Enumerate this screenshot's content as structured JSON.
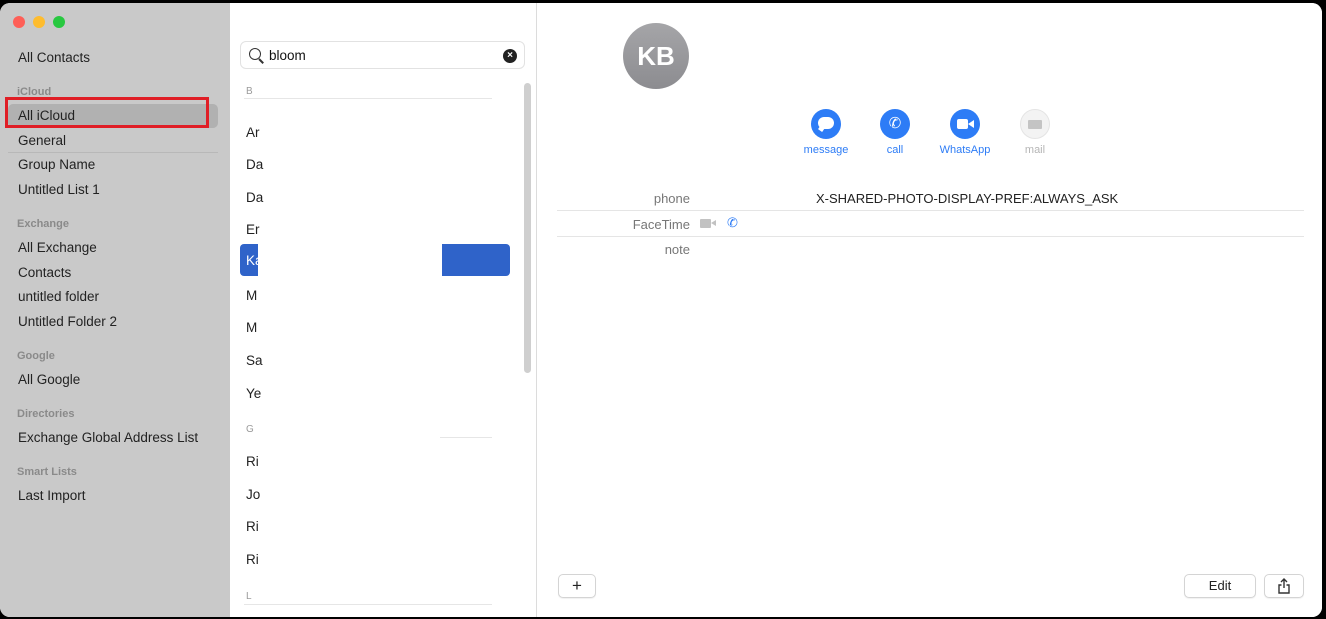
{
  "sidebar": {
    "all_contacts": "All Contacts",
    "icloud_header": "iCloud",
    "icloud_items": [
      "All iCloud",
      "General",
      "Group Name",
      "Untitled List 1"
    ],
    "exchange_header": "Exchange",
    "exchange_items": [
      "All Exchange",
      "Contacts",
      "untitled folder",
      "Untitled Folder 2"
    ],
    "google_header": "Google",
    "google_items": [
      "All Google"
    ],
    "directories_header": "Directories",
    "directories_items": [
      "Exchange Global Address List"
    ],
    "smart_header": "Smart Lists",
    "smart_items": [
      "Last Import"
    ]
  },
  "list": {
    "search_value": "bloom",
    "section_b": "B",
    "section_g": "G",
    "section_l": "L",
    "rows_b": [
      "Ar",
      "Da",
      "Da",
      "Er",
      "Ka",
      "M",
      "M",
      "Sa",
      "Ye"
    ],
    "rows_g": [
      "Ri",
      "Jo",
      "Ri",
      "Ri"
    ]
  },
  "detail": {
    "initials": "KB",
    "actions": [
      "message",
      "call",
      "WhatsApp",
      "mail"
    ],
    "fields": {
      "phone_label": "phone",
      "phone_value": "X-SHARED-PHOTO-DISPLAY-PREF:ALWAYS_ASK",
      "facetime_label": "FaceTime",
      "note_label": "note"
    },
    "add_label": "+",
    "edit_label": "Edit",
    "share_icon": "share-icon"
  }
}
